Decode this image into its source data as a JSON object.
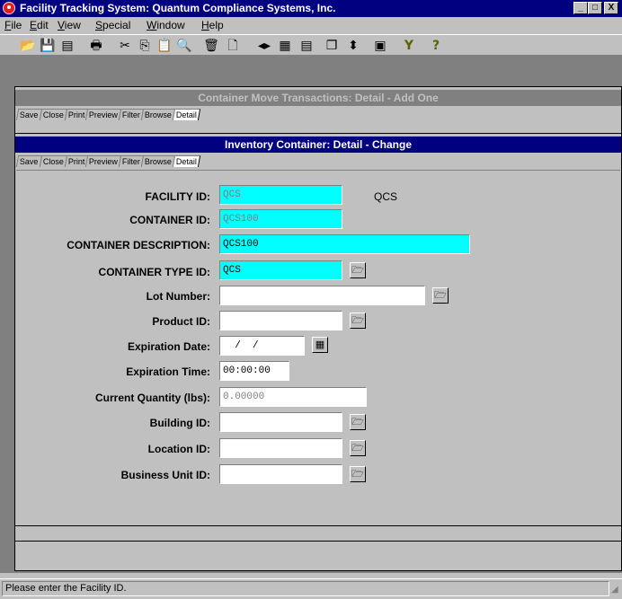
{
  "window": {
    "title": "Facility Tracking System: Quantum Compliance Systems, Inc.",
    "min_label": "_",
    "max_label": "□",
    "close_label": "X"
  },
  "menu": {
    "items": [
      {
        "u": "F",
        "rest": "ile"
      },
      {
        "u": "E",
        "rest": "dit"
      },
      {
        "u": "V",
        "rest": "iew"
      },
      {
        "u": "S",
        "rest": "pecial"
      },
      {
        "u": "W",
        "rest": "indow"
      },
      {
        "u": "H",
        "rest": "elp"
      }
    ]
  },
  "toolbar": {
    "icons": [
      "open-folder-icon",
      "save-disk-icon",
      "open-record-icon",
      "print-icon",
      "cut-icon",
      "copy-icon",
      "paste-icon",
      "preview-icon",
      "delete-icon",
      "new-document-icon",
      "navigate-icon",
      "grid-icon",
      "form-view-icon",
      "cascade-icon",
      "sort-icon",
      "calculator-icon",
      "filter-icon",
      "help-icon"
    ],
    "glyphs": [
      "📂",
      "💾",
      "▤",
      "🖶",
      "✂",
      "⎘",
      "📋",
      "🔍",
      "🗑",
      "🗋",
      "◂▸",
      "▦",
      "▤",
      "❐",
      "⬍",
      "▣",
      "Y",
      "?"
    ]
  },
  "outer_child": {
    "title": "Container Move Transactions: Detail - Add One",
    "tabs": [
      "Save",
      "Close",
      "Print",
      "Preview",
      "Filter",
      "Browse",
      "Detail"
    ],
    "active_tab": "Detail"
  },
  "inner_child": {
    "title": "Inventory Container: Detail - Change",
    "tabs": [
      "Save",
      "Close",
      "Print",
      "Preview",
      "Filter",
      "Browse",
      "Detail"
    ],
    "active_tab": "Detail"
  },
  "form": {
    "facility_id": {
      "label": "FACILITY ID:",
      "value": "QCS",
      "extra": "QCS"
    },
    "container_id": {
      "label": "CONTAINER ID:",
      "value": "QCS100"
    },
    "container_description": {
      "label": "CONTAINER DESCRIPTION:",
      "value": "QCS100"
    },
    "container_type_id": {
      "label": "CONTAINER TYPE ID:",
      "value": "QCS"
    },
    "lot_number": {
      "label": "Lot Number:",
      "value": ""
    },
    "product_id": {
      "label": "Product ID:",
      "value": ""
    },
    "expiration_date": {
      "label": "Expiration Date:",
      "value": "  /  /"
    },
    "expiration_time": {
      "label": "Expiration Time:",
      "value": "00:00:00"
    },
    "current_quantity": {
      "label": "Current Quantity (lbs):",
      "value": "0.00000"
    },
    "building_id": {
      "label": "Building ID:",
      "value": ""
    },
    "location_id": {
      "label": "Location ID:",
      "value": ""
    },
    "business_unit_id": {
      "label": "Business Unit ID:",
      "value": ""
    }
  },
  "status": {
    "message": "Please enter the Facility ID."
  },
  "colors": {
    "title_active": "#000080",
    "title_inactive": "#808080",
    "required_field": "#00ffff",
    "face": "#c0c0c0"
  }
}
